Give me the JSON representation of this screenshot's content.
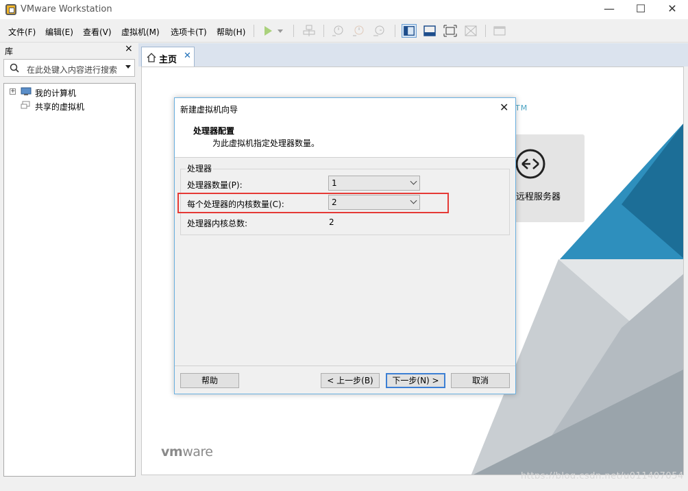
{
  "window": {
    "title": "VMware Workstation",
    "controls": {
      "minimize": "—",
      "maximize": "☐",
      "close": "✕"
    }
  },
  "menu": {
    "items": [
      "文件(F)",
      "编辑(E)",
      "查看(V)",
      "虚拟机(M)",
      "选项卡(T)",
      "帮助(H)"
    ]
  },
  "toolbar": {
    "icons": [
      "play-icon",
      "play-dropdown-icon",
      "send-ctrl-alt-del-icon",
      "snapshot-icon",
      "revert-snapshot-icon",
      "manage-snapshots-icon",
      "show-library-icon",
      "thumbnail-bar-icon",
      "full-screen-icon",
      "unity-icon",
      "console-view-icon"
    ]
  },
  "library": {
    "title": "库",
    "close": "×",
    "search_placeholder": "在此处键入内容进行搜索",
    "tree": [
      {
        "label": "我的计算机",
        "expandable": true,
        "expander": "+"
      },
      {
        "label": "共享的虚拟机",
        "expandable": false
      }
    ]
  },
  "tabs": [
    {
      "label": "主页",
      "close": "✕",
      "active": true
    }
  ],
  "home": {
    "tm": "TM",
    "remote_server_label": "远程服务器",
    "logo_prefix": "vm",
    "logo_suffix": "ware",
    "watermark": "https://blog.csdn.net/u011407054"
  },
  "dialog": {
    "title": "新建虚拟机向导",
    "close": "✕",
    "heading": "处理器配置",
    "subheading": "为此虚拟机指定处理器数量。",
    "group_label": "处理器",
    "processor_count": {
      "label": "处理器数量(P):",
      "value": "1"
    },
    "cores_per_processor": {
      "label": "每个处理器的内核数量(C):",
      "value": "2"
    },
    "total_cores": {
      "label": "处理器内核总数:",
      "value": "2"
    },
    "buttons": {
      "help": "帮助",
      "back": "< 上一步(B)",
      "next": "下一步(N) >",
      "cancel": "取消"
    }
  },
  "colors": {
    "accent_blue": "#3c7fd4",
    "highlight_red": "#e53935",
    "teal": "#2b9ac4",
    "dialog_border": "#6ab0e0"
  }
}
